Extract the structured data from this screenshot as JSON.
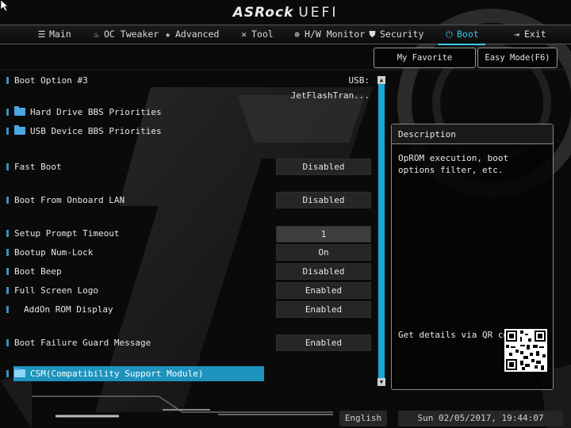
{
  "brand": {
    "name": "ASRock",
    "suffix": "UEFI"
  },
  "nav": {
    "tabs": [
      {
        "label": "Main",
        "icon": "list-icon"
      },
      {
        "label": "OC Tweaker",
        "icon": "flame-icon"
      },
      {
        "label": "Advanced",
        "icon": "star-icon"
      },
      {
        "label": "Tool",
        "icon": "tools-icon"
      },
      {
        "label": "H/W Monitor",
        "icon": "crosshair-icon"
      },
      {
        "label": "Security",
        "icon": "shield-icon"
      },
      {
        "label": "Boot",
        "icon": "power-icon",
        "active": true
      },
      {
        "label": "Exit",
        "icon": "exit-icon"
      }
    ]
  },
  "buttons": {
    "favorite": "My Favorite",
    "easy_mode": "Easy Mode(F6)"
  },
  "options": {
    "boot_option_3": {
      "label": "Boot Option #3",
      "value": "USB: JetFlashTran..."
    },
    "hdd_bbs": {
      "label": "Hard Drive BBS Priorities"
    },
    "usb_bbs": {
      "label": "USB Device BBS Priorities"
    },
    "fast_boot": {
      "label": "Fast Boot",
      "value": "Disabled"
    },
    "boot_lan": {
      "label": "Boot From Onboard LAN",
      "value": "Disabled"
    },
    "setup_timeout": {
      "label": "Setup Prompt Timeout",
      "value": "1"
    },
    "numlock": {
      "label": "Bootup Num-Lock",
      "value": "On"
    },
    "beep": {
      "label": "Boot Beep",
      "value": "Disabled"
    },
    "logo": {
      "label": "Full Screen Logo",
      "value": "Enabled"
    },
    "addon_rom": {
      "label": "AddOn ROM Display",
      "value": "Enabled"
    },
    "guard_msg": {
      "label": "Boot Failure Guard Message",
      "value": "Enabled"
    },
    "csm": {
      "label": "CSM(Compatibility Support Module)"
    }
  },
  "description": {
    "title": "Description",
    "text": "OpROM execution, boot options filter, etc.",
    "qr_text": "Get details via QR code"
  },
  "footer": {
    "language": "English",
    "datetime": "Sun 02/05/2017, 19:44:07"
  },
  "colors": {
    "accent": "#1d93bd",
    "active_tab": "#3cc8f0",
    "scrollbar": "#19a7d6"
  }
}
